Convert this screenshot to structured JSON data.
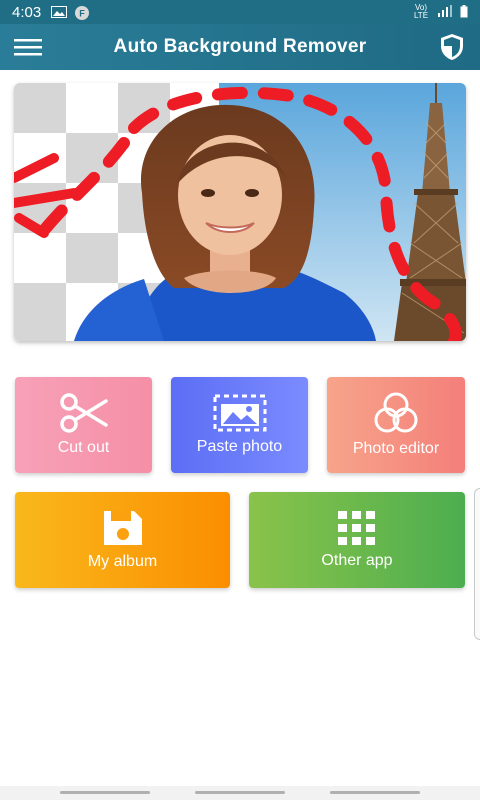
{
  "status_bar": {
    "time": "4:03",
    "network": "Vo) LTE"
  },
  "app_bar": {
    "title": "Auto Background Remover"
  },
  "actions": {
    "cut_out": "Cut out",
    "paste_photo": "Paste photo",
    "photo_editor": "Photo editor",
    "my_album": "My album",
    "other_app": "Other app"
  },
  "colors": {
    "app_bar": "#1f6e86",
    "cut_out": "#f58fa6",
    "paste_photo": "#6a7cfa",
    "photo_editor": "#f4907f",
    "my_album": "#fba00e",
    "other_app": "#6bb94c"
  },
  "icons": {
    "menu": "hamburger-menu-icon",
    "shield": "shield-icon",
    "cut_out": "scissors-icon",
    "paste_photo": "paste-image-icon",
    "photo_editor": "color-filter-icon",
    "my_album": "floppy-disk-icon",
    "other_app": "grid-apps-icon"
  }
}
